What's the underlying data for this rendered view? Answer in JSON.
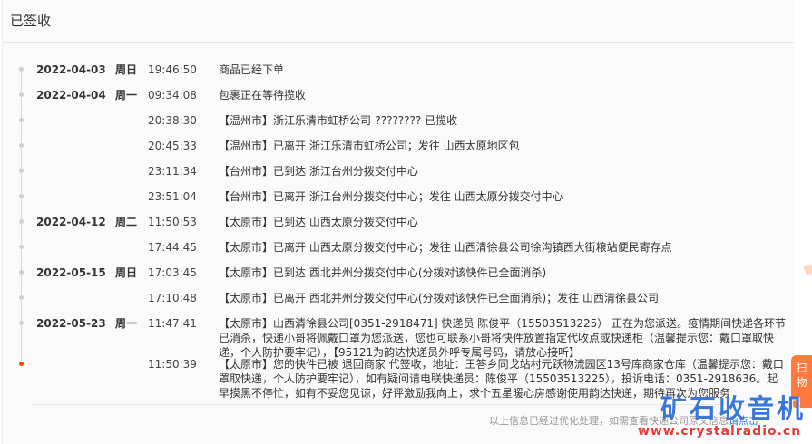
{
  "header": {
    "title": "已签收"
  },
  "rows": [
    {
      "date": "2022-04-03",
      "week": "周日",
      "time": "19:46:50",
      "info": "商品已经下单"
    },
    {
      "date": "2022-04-04",
      "week": "周一",
      "time": "09:34:08",
      "info": "包裹正在等待揽收"
    },
    {
      "date": "",
      "week": "",
      "time": "20:38:30",
      "info": "【温州市】浙江乐清市虹桥公司-???????? 已揽收"
    },
    {
      "date": "",
      "week": "",
      "time": "20:45:33",
      "info": "【温州市】已离开 浙江乐清市虹桥公司；发往 山西太原地区包"
    },
    {
      "date": "",
      "week": "",
      "time": "23:11:34",
      "info": "【台州市】已到达 浙江台州分拨交付中心"
    },
    {
      "date": "",
      "week": "",
      "time": "23:51:04",
      "info": "【台州市】已离开 浙江台州分拨交付中心；发往 山西太原分拨交付中心"
    },
    {
      "date": "2022-04-12",
      "week": "周二",
      "time": "11:50:53",
      "info": "【太原市】已到达 山西太原分拨交付中心"
    },
    {
      "date": "",
      "week": "",
      "time": "17:44:45",
      "info": "【太原市】已离开 山西太原分拨交付中心；发往 山西清徐县公司徐沟镇西大街粮站便民寄存点"
    },
    {
      "date": "2022-05-15",
      "week": "周日",
      "time": "17:03:45",
      "info": "【太原市】已到达 西北并州分拨交付中心(分拨对该快件已全面消杀)"
    },
    {
      "date": "",
      "week": "",
      "time": "17:10:48",
      "info": "【太原市】已离开 西北并州分拨交付中心(分拨对该快件已全面消杀)；发往 山西清徐县公司"
    },
    {
      "date": "2022-05-23",
      "week": "周一",
      "time": "11:47:41",
      "info": "【太原市】山西清徐县公司[0351-2918471] 快递员 陈俊平（15503513225） 正在为您派送。疫情期间快递各环节已消杀，快递小哥将佩戴口罩为您派送，您也可联系小哥将快件放置指定代收点或快递柜（温馨提示您：戴口罩取快递，个人防护要牢记），【95121为韵达快递员外呼专属号码，请放心接听】"
    },
    {
      "date": "",
      "week": "",
      "time": "11:50:39",
      "info": "【太原市】您的快件已被 退回商家 代签收，地址：王答乡同戈站村元跃物流园区13号库商家仓库（温馨提示您：戴口罩取快递，个人防护要牢记），如有疑问请电联快递员：陈俊平（15503513225），投诉电话：0351-2918636。起早摸黑不停忙，如有不妥您见谅，好评激励我向上，求个五星暖心房感谢使用韵达快递，期待再次为您服务"
    }
  ],
  "footer": {
    "note": "以上信息已经过优化处理，如需查看快递公司原文信息",
    "link": "请点击"
  },
  "side_badge": "扫物",
  "watermark": {
    "text": "矿石收音机",
    "url": "www.crystalradio.cn"
  },
  "colors": {
    "active_dot": "#ff4400",
    "link": "#3a6fc7"
  }
}
